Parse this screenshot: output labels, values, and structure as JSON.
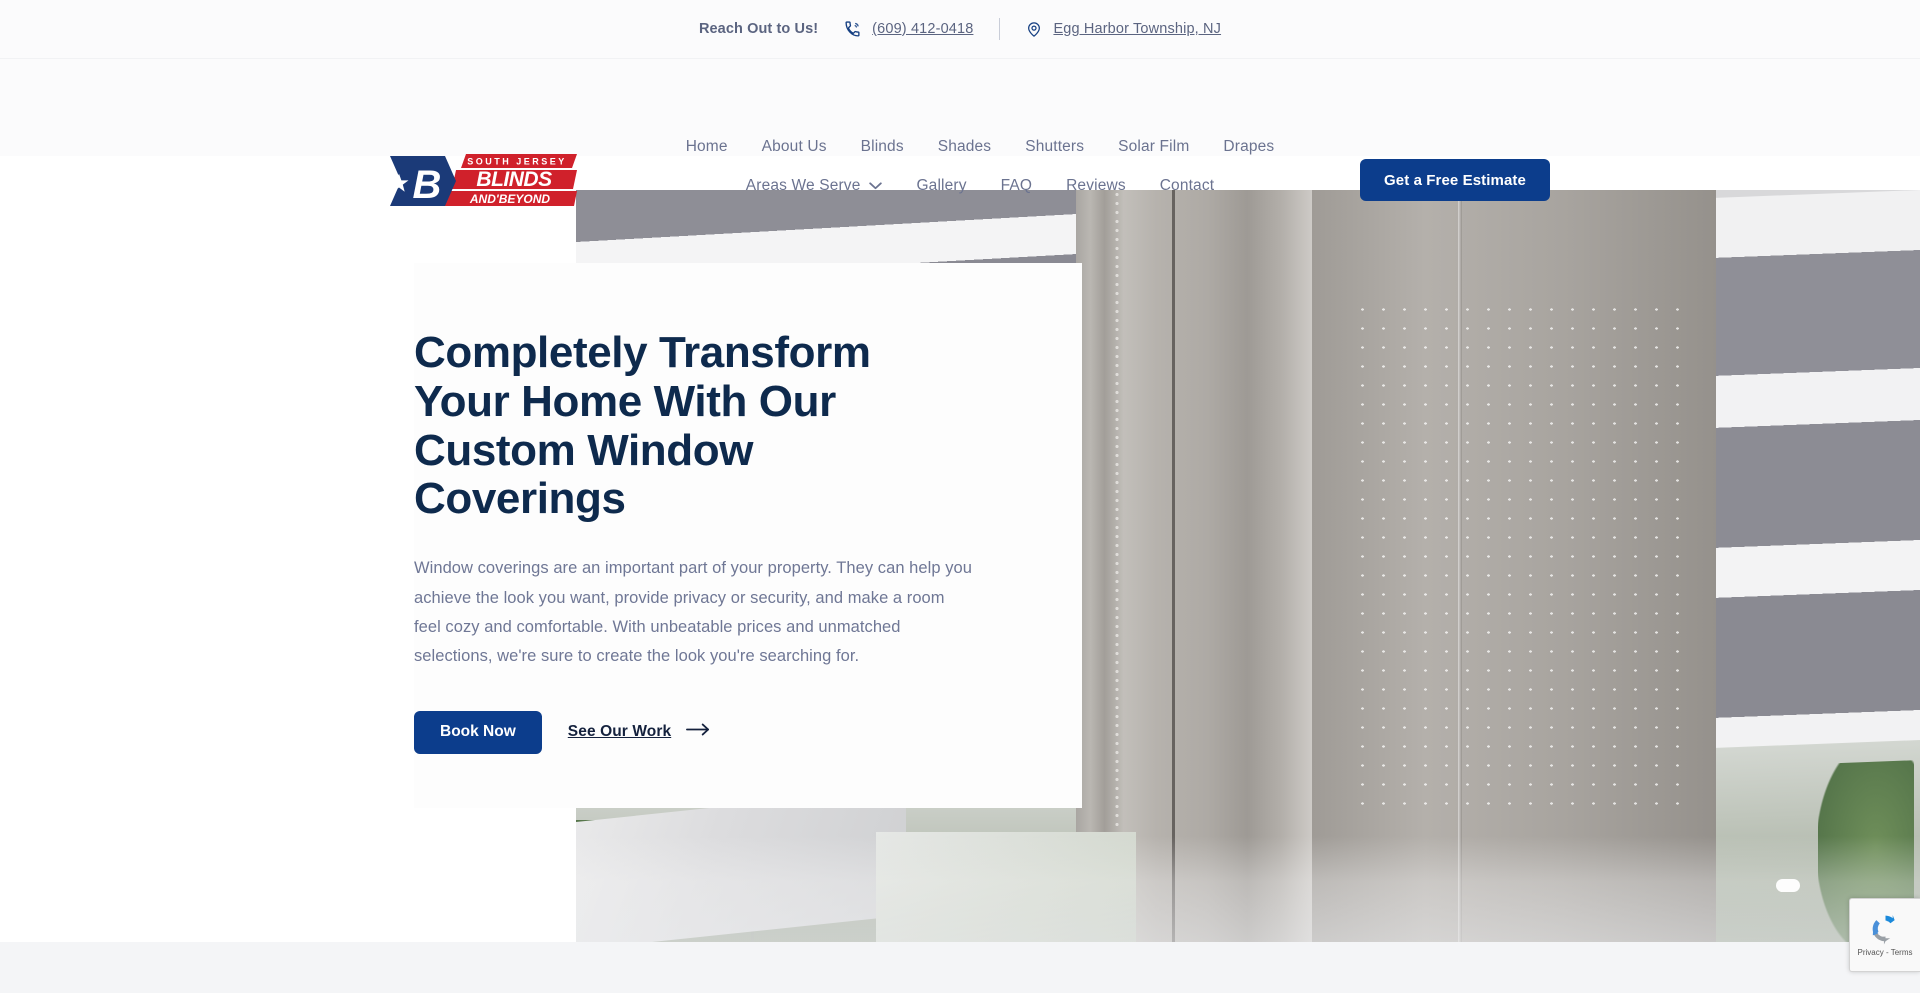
{
  "topbar": {
    "label": "Reach Out to Us!",
    "phone": "(609) 412-0418",
    "phone_icon": "phone-ring-icon",
    "location": "Egg Harbor Township, NJ",
    "location_icon": "map-pin-icon"
  },
  "logo": {
    "tagline": "SOUTH JERSEY",
    "name": "BLINDS",
    "sub": "AND BEYOND",
    "letter": "B",
    "blue": "#1b3a78",
    "red": "#d0212b"
  },
  "nav": {
    "row1": [
      {
        "label": "Home"
      },
      {
        "label": "About Us"
      },
      {
        "label": "Blinds"
      },
      {
        "label": "Shades"
      },
      {
        "label": "Shutters"
      },
      {
        "label": "Solar Film"
      },
      {
        "label": "Drapes"
      }
    ],
    "row2": [
      {
        "label": "Areas We Serve",
        "dropdown": true,
        "icon": "chevron-down-icon"
      },
      {
        "label": "Gallery"
      },
      {
        "label": "FAQ"
      },
      {
        "label": "Reviews"
      },
      {
        "label": "Contact"
      }
    ],
    "cta": "Get a Free Estimate"
  },
  "hero": {
    "title": "Completely Transform Your Home With Our Custom Window Coverings",
    "paragraph": "Window coverings are an important part of your property. They can help you achieve the look you want, provide privacy or security, and make a room feel cozy and comfortable. With unbeatable prices and unmatched selections, we're sure to create the look you're searching for.",
    "primary_button": "Book Now",
    "secondary_link": "See Our Work",
    "secondary_icon": "arrow-right-icon",
    "image_alt": "Gray zebra roller shades on a window"
  },
  "recaptcha": {
    "text": "Privacy - Terms",
    "icon": "recaptcha-icon"
  },
  "colors": {
    "brand_blue": "#0c3d8c",
    "heading_navy": "#0e2a4d",
    "body_gray": "#6f7795",
    "nav_gray": "#6b7390",
    "topbar_bg": "#fbfbfc",
    "footer_bg": "#f4f5f7"
  }
}
